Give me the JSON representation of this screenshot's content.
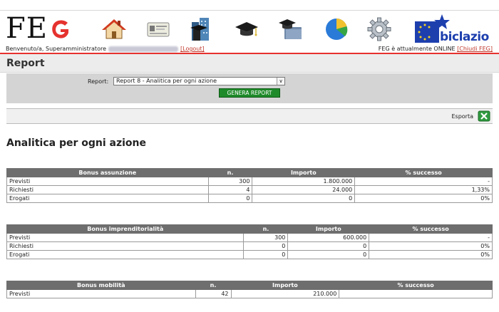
{
  "header": {
    "logo_text": "FE",
    "welcome_prefix": "Benvenuto/a, Superamministratore",
    "logout_label": "[Logout]",
    "status_text": "FEG è attualmente ONLINE",
    "close_label": "[Chiudi FEG]",
    "biclazio_label": "biclazio",
    "nav_icons": [
      "home-icon",
      "id-card-icon",
      "buildings-icon",
      "graduation-cap-icon",
      "graduation-folder-icon",
      "pie-chart-icon",
      "gear-icon"
    ]
  },
  "page": {
    "title": "Report"
  },
  "filter": {
    "label": "Report:",
    "selected": "Report 8 - Analitica per ogni azione",
    "button": "GENERA REPORT"
  },
  "export": {
    "label": "Esporta"
  },
  "section": {
    "title": "Analitica per ogni azione"
  },
  "tables": [
    {
      "headers": [
        "Bonus assunzione",
        "n.",
        "Importo",
        "% successo"
      ],
      "rows": [
        [
          "Previsti",
          "300",
          "1.800.000",
          "-"
        ],
        [
          "Richiesti",
          "4",
          "24.000",
          "1,33%"
        ],
        [
          "Erogati",
          "0",
          "0",
          "0%"
        ]
      ]
    },
    {
      "headers": [
        "Bonus imprenditorialità",
        "n.",
        "Importo",
        "% successo"
      ],
      "rows": [
        [
          "Previsti",
          "300",
          "600.000",
          "-"
        ],
        [
          "Richiesti",
          "0",
          "0",
          "0%"
        ],
        [
          "Erogati",
          "0",
          "0",
          "0%"
        ]
      ]
    },
    {
      "headers": [
        "Bonus mobilità",
        "n.",
        "Importo",
        "% successo"
      ],
      "rows": [
        [
          "Previsti",
          "42",
          "210.000",
          ""
        ]
      ]
    }
  ]
}
